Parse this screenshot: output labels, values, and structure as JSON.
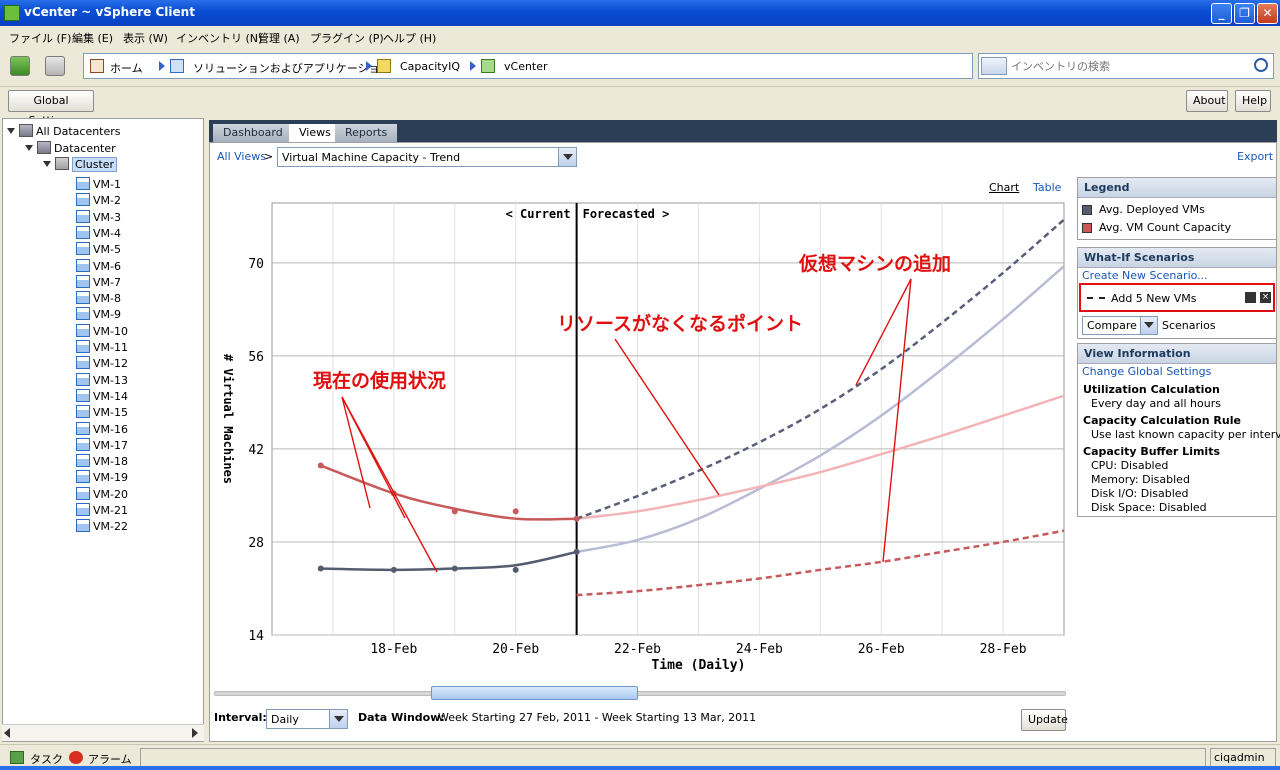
{
  "window": {
    "title": "vCenter  ~  vSphere Client"
  },
  "menu": [
    "ファイル (F)",
    "編集 (E)",
    "表示 (W)",
    "インベントリ (N)",
    "管理 (A)",
    "プラグイン (P)",
    "ヘルプ (H)"
  ],
  "breadcrumb": [
    "ホーム",
    "ソリューションおよびアプリケーション",
    "CapacityIQ",
    "vCenter"
  ],
  "search": {
    "placeholder": "インベントリの検索"
  },
  "toolbar": {
    "global_settings": "Global Settings",
    "about": "About",
    "help": "Help"
  },
  "tree": {
    "root": "All Datacenters",
    "datacenter": "Datacenter",
    "cluster": "Cluster",
    "vms": [
      "VM-1",
      "VM-2",
      "VM-3",
      "VM-4",
      "VM-5",
      "VM-6",
      "VM-7",
      "VM-8",
      "VM-9",
      "VM-10",
      "VM-11",
      "VM-12",
      "VM-13",
      "VM-14",
      "VM-15",
      "VM-16",
      "VM-17",
      "VM-18",
      "VM-19",
      "VM-20",
      "VM-21",
      "VM-22"
    ]
  },
  "tabs": [
    "Dashboard",
    "Views",
    "Reports"
  ],
  "view": {
    "all_views": "All Views",
    "separator": ">",
    "selected": "Virtual Machine Capacity - Trend",
    "export": "Export",
    "chart_link": "Chart",
    "table_link": "Table"
  },
  "legend": {
    "title": "Legend",
    "items": [
      {
        "label": "Avg. Deployed VMs",
        "color": "#555c70"
      },
      {
        "label": "Avg. VM Count Capacity",
        "color": "#c65a5a"
      }
    ]
  },
  "whatif": {
    "title": "What-If Scenarios",
    "create": "Create New Scenario...",
    "scenario": "Add 5 New VMs",
    "compare": "Compare",
    "scenarios_label": "Scenarios"
  },
  "viewinfo": {
    "title": "View Information",
    "change": "Change Global Settings",
    "utilization_title": "Utilization Calculation",
    "utilization_value": "Every day and all hours",
    "rule_title": "Capacity Calculation Rule",
    "rule_value": "Use last known capacity per interval",
    "buffer_title": "Capacity Buffer Limits",
    "buffer_items": [
      "CPU: Disabled",
      "Memory: Disabled",
      "Disk I/O: Disabled",
      "Disk Space: Disabled"
    ]
  },
  "bottom": {
    "interval_label": "Interval:",
    "interval_value": "Daily",
    "data_window_label": "Data Window:",
    "data_window_value": "Week Starting 27 Feb, 2011 - Week Starting 13 Mar, 2011",
    "update": "Update"
  },
  "statusbar": {
    "tasks": "タスク",
    "alarms": "アラーム",
    "user": "ciqadmin"
  },
  "annotations": {
    "current_usage": "現在の使用状況",
    "resource_exhaustion": "リソースがなくなるポイント",
    "add_vms": "仮想マシンの追加"
  },
  "chart_data": {
    "type": "line",
    "xlabel": "Time (Daily)",
    "ylabel": "# Virtual Machines",
    "x_ticks": [
      "18-Feb",
      "20-Feb",
      "22-Feb",
      "24-Feb",
      "26-Feb",
      "28-Feb"
    ],
    "y_ticks": [
      14,
      28,
      42,
      56,
      70
    ],
    "ylim": [
      14,
      79
    ],
    "markers": {
      "current": "< Current",
      "forecasted": "Forecasted >",
      "divider_day": 21
    },
    "series": [
      {
        "name": "Avg. Deployed VMs",
        "color": "#555c70",
        "actual": [
          [
            16.8,
            24.0
          ],
          [
            18,
            23.8
          ],
          [
            19,
            24.0
          ],
          [
            20,
            24.5
          ],
          [
            21,
            26.5
          ]
        ],
        "points": [
          [
            16.8,
            24.0
          ],
          [
            18,
            23.8
          ],
          [
            19,
            24.0
          ],
          [
            20,
            23.8
          ],
          [
            21,
            26.5
          ]
        ],
        "forecast": [
          [
            21,
            26.5
          ],
          [
            22,
            28.3
          ],
          [
            23,
            31.5
          ],
          [
            24,
            36.0
          ],
          [
            25,
            41.0
          ],
          [
            26,
            47.0
          ],
          [
            27,
            54.0
          ],
          [
            28,
            61.5
          ],
          [
            29,
            69.5
          ]
        ]
      },
      {
        "name": "Avg. VM Count Capacity",
        "color": "#c65a5a",
        "actual": [
          [
            16.8,
            39.5
          ],
          [
            18,
            35.3
          ],
          [
            19,
            33.0
          ],
          [
            20,
            31.5
          ],
          [
            21,
            31.5
          ]
        ],
        "points": [
          [
            16.8,
            39.5
          ],
          [
            18,
            35.3
          ],
          [
            19,
            32.6
          ],
          [
            20,
            32.6
          ],
          [
            21,
            31.5
          ]
        ],
        "forecast": [
          [
            21,
            31.5
          ],
          [
            22,
            32.6
          ],
          [
            23,
            34.3
          ],
          [
            24,
            36.3
          ],
          [
            25,
            38.5
          ],
          [
            26,
            41.2
          ],
          [
            27,
            44.0
          ],
          [
            28,
            47.0
          ],
          [
            29,
            50.0
          ]
        ]
      },
      {
        "name": "Add 5 New VMs",
        "color": "#5a5f78",
        "dashed": true,
        "values": [
          [
            21,
            31.5
          ],
          [
            22,
            34.9
          ],
          [
            23,
            38.7
          ],
          [
            24,
            43.0
          ],
          [
            25,
            48.0
          ],
          [
            26,
            54.0
          ],
          [
            27,
            61.0
          ],
          [
            28,
            68.5
          ],
          [
            29,
            76.5
          ]
        ]
      },
      {
        "name": "Add 5 New VMs capacity",
        "color": "#c65a5a",
        "dashed": true,
        "values": [
          [
            21,
            20.0
          ],
          [
            22,
            20.6
          ],
          [
            23,
            21.5
          ],
          [
            24,
            22.5
          ],
          [
            25,
            23.8
          ],
          [
            26,
            25.0
          ],
          [
            27,
            26.5
          ],
          [
            28,
            28.0
          ],
          [
            29,
            29.7
          ]
        ]
      }
    ]
  }
}
